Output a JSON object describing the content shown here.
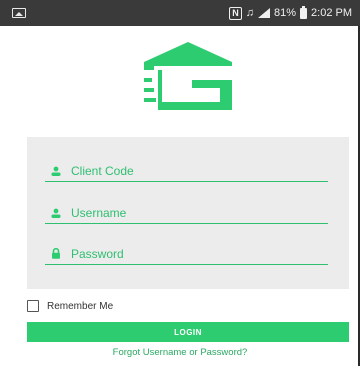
{
  "status_bar": {
    "nfc": "N",
    "vibrate": "♫",
    "battery_percent": "81%",
    "time": "2:02 PM"
  },
  "icons": {
    "gallery": "image-icon",
    "signal": "signal-icon",
    "battery": "battery-icon",
    "user": "person-icon",
    "lock": "lock-icon"
  },
  "login_form": {
    "client_code_placeholder": "Client Code",
    "username_placeholder": "Username",
    "password_placeholder": "Password",
    "remember_me_label": "Remember Me",
    "remember_me_checked": false,
    "login_label": "LOGIN",
    "forgot_label": "Forgot Username or Password?"
  },
  "colors": {
    "accent": "#2ecc71",
    "underline": "#2fbf71",
    "link": "#2aa863",
    "panel": "#ececec",
    "status_bar": "#3a3a3a"
  }
}
